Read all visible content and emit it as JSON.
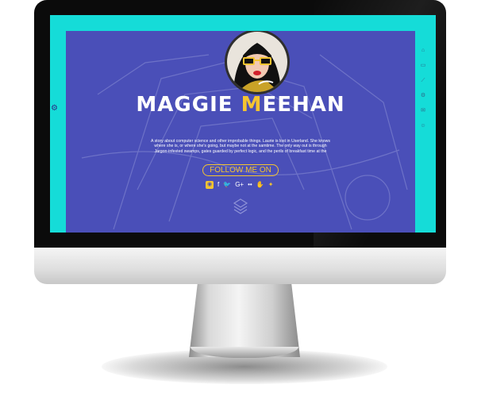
{
  "profile": {
    "name_first": "MAGGIE ",
    "name_accent": "M",
    "name_rest": "EEHAN",
    "bio": "A story about computer science and other improbable things. Laurie is lost in Userland. She knows where she is, or where she's going, but maybe not at the samtime. The only way out is through Jargon-infested swamps, gates guarded by perfect logic, and the perils of breakfast time at the",
    "follow_label": "FOLLOW ME ON"
  },
  "socials": [
    {
      "icon": "instagram-icon",
      "glyph": "◉"
    },
    {
      "icon": "facebook-icon",
      "glyph": "f"
    },
    {
      "icon": "twitter-icon",
      "glyph": "🐦"
    },
    {
      "icon": "google-plus-icon",
      "glyph": "G+"
    },
    {
      "icon": "flickr-icon",
      "glyph": "••"
    },
    {
      "icon": "hand-icon",
      "glyph": "✋"
    },
    {
      "icon": "star-icon",
      "glyph": "✦"
    }
  ],
  "side_menu": [
    {
      "icon": "home-icon",
      "glyph": "⌂"
    },
    {
      "icon": "document-icon",
      "glyph": "▭"
    },
    {
      "icon": "chart-icon",
      "glyph": "⟋"
    },
    {
      "icon": "gear-icon",
      "glyph": "⚙"
    },
    {
      "icon": "mail-icon",
      "glyph": "✉"
    },
    {
      "icon": "user-icon",
      "glyph": "☺"
    }
  ],
  "colors": {
    "screen_frame": "#15dcd8",
    "content_bg": "#4a4fb8",
    "accent": "#f4c430",
    "text": "#ffffff"
  }
}
